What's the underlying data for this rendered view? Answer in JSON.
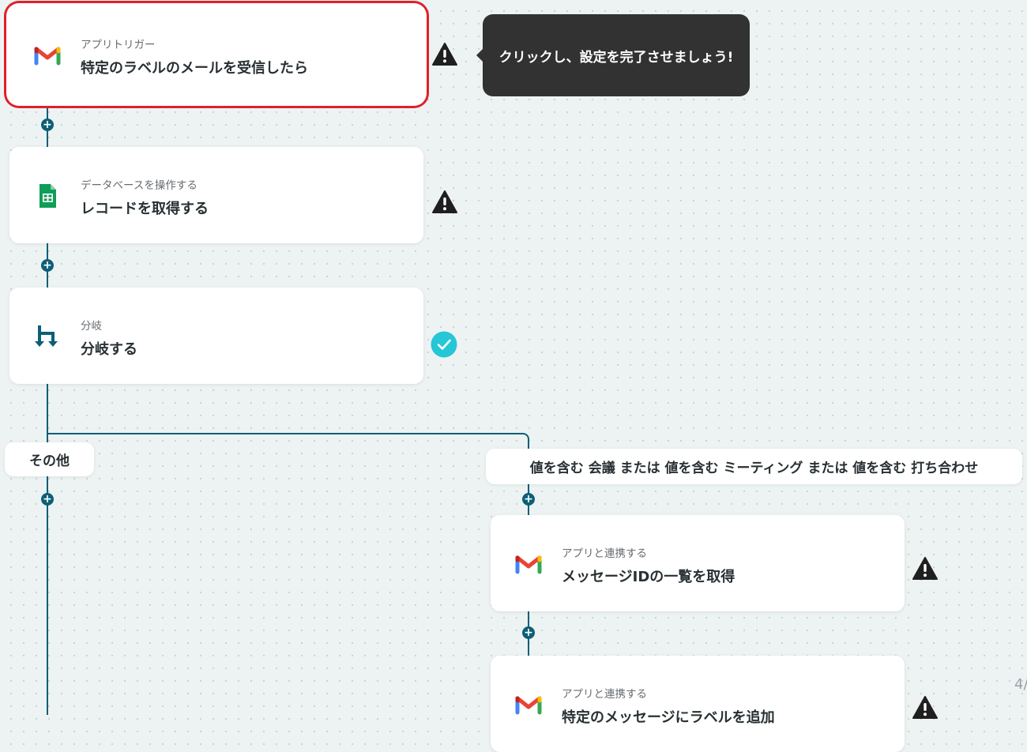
{
  "colors": {
    "background": "#edf3f3",
    "connector": "#0d5f77",
    "selection": "#e0202a",
    "warning": "#1f1f1f",
    "success": "#25c6d6",
    "tooltip": "#323232"
  },
  "tooltip": {
    "text": "クリックし、設定を完了させましょう!"
  },
  "steps": [
    {
      "subtitle": "アプリトリガー",
      "title": "特定のラベルのメールを受信したら",
      "icon": "gmail-icon",
      "status": "warning-icon",
      "selected": true
    },
    {
      "subtitle": "データベースを操作する",
      "title": "レコードを取得する",
      "icon": "google-sheets-icon",
      "status": "warning-icon"
    },
    {
      "subtitle": "分岐",
      "title": "分岐する",
      "icon": "branch-icon",
      "status": "check-icon"
    }
  ],
  "branches": {
    "other_label": "その他",
    "condition_label": "値を含む 会議 または 値を含む ミーティング または 値を含む 打ち合わせ"
  },
  "branch_steps": [
    {
      "subtitle": "アプリと連携する",
      "title": "メッセージIDの一覧を取得",
      "icon": "gmail-icon",
      "status": "warning-icon"
    },
    {
      "subtitle": "アプリと連携する",
      "title": "特定のメッセージにラベルを追加",
      "icon": "gmail-icon",
      "status": "warning-icon"
    }
  ],
  "page_indicator": "4/"
}
